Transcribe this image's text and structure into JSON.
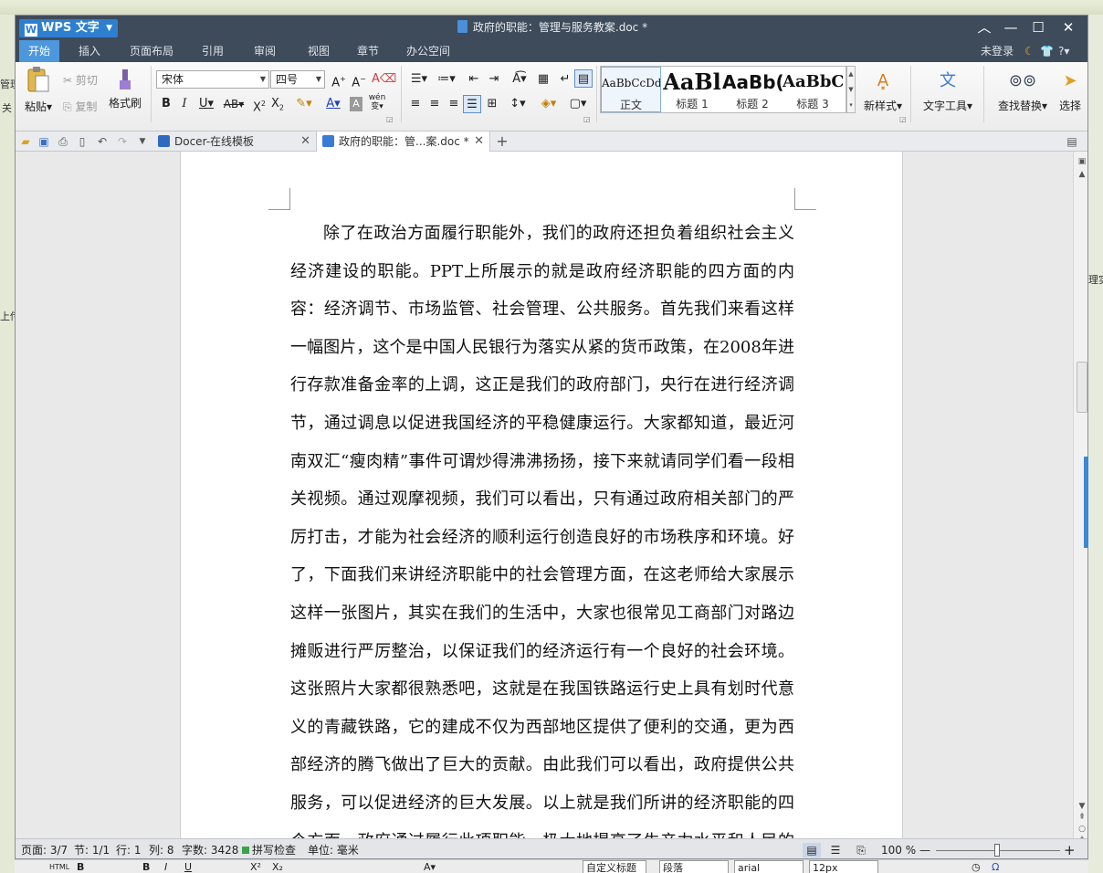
{
  "app": {
    "name": "WPS 文字",
    "doc_title": "政府的职能：管理与服务教案.doc *"
  },
  "menubar": {
    "items": [
      "开始",
      "插入",
      "页面布局",
      "引用",
      "审阅",
      "视图",
      "章节",
      "办公空间"
    ],
    "active": "开始",
    "login": "未登录",
    "help": "?"
  },
  "ribbon": {
    "paste": "粘贴",
    "cut": "剪切",
    "copy": "复制",
    "format_painter": "格式刷",
    "font_name": "宋体",
    "font_size": "四号",
    "styles": [
      {
        "sample": "AaBbCcDd",
        "label": "正文"
      },
      {
        "sample": "AaBl",
        "label": "标题 1"
      },
      {
        "sample": "AaBb(",
        "label": "标题 2"
      },
      {
        "sample": "AaBbC",
        "label": "标题 3"
      }
    ],
    "new_style": "新样式",
    "text_tools": "文字工具",
    "find_replace": "查找替换",
    "select": "选择",
    "pinyin": "wén"
  },
  "tabs": [
    {
      "label": "Docer-在线模板",
      "active": false
    },
    {
      "label": "政府的职能：管...案.doc *",
      "active": true
    }
  ],
  "document": {
    "paragraph": "除了在政治方面履行职能外，我们的政府还担负着组织社会主义经济建设的职能。PPT上所展示的就是政府经济职能的四方面的内容：经济调节、市场监管、社会管理、公共服务。首先我们来看这样一幅图片，这个是中国人民银行为落实从紧的货币政策，在2008年进行存款准备金率的上调，这正是我们的政府部门，央行在进行经济调节，通过调息以促进我国经济的平稳健康运行。大家都知道，最近河南双汇“瘦肉精”事件可谓炒得沸沸扬扬，接下来就请同学们看一段相关视频。通过观摩视频，我们可以看出，只有通过政府相关部门的严厉打击，才能为社会经济的顺利运行创造良好的市场秩序和环境。好了，下面我们来讲经济职能中的社会管理方面，在这老师给大家展示这样一张图片，其实在我们的生活中，大家也很常见工商部门对路边摊贩进行严厉整治，以保证我们的经济运行有一个良好的社会环境。这张照片大家都很熟悉吧，这就是在我国铁路运行史上具有划时代意义的青藏铁路，它的建成不仅为西部地区提供了便利的交通，更为西部经济的腾飞做出了巨大的贡献。由此我们可以看出，政府提供公共服务，可以促进经济的巨大发展。以上就是我们所讲的经济职能的四个方面，政府通过履行此项职能，极大地提高了生产力水平和人民的生活"
  },
  "status": {
    "page": "页面: 3/7",
    "section": "节: 1/1",
    "row": "行: 1",
    "col": "列: 8",
    "words": "字数: 3428",
    "spell": "拼写检查",
    "unit": "单位: 毫米",
    "zoom": "100 %"
  },
  "background": {
    "left_frags": [
      "管理",
      "关",
      "上传"
    ],
    "right_frags": [
      "理实"
    ],
    "bottom": {
      "html": "HTML",
      "style": "自定义标题",
      "para": "段落",
      "font": "arial",
      "size": "12px"
    }
  },
  "colors": {
    "titlebar": "#3e4b5b",
    "accent": "#4d97dd",
    "wps_blue": "#2e7fd0"
  }
}
